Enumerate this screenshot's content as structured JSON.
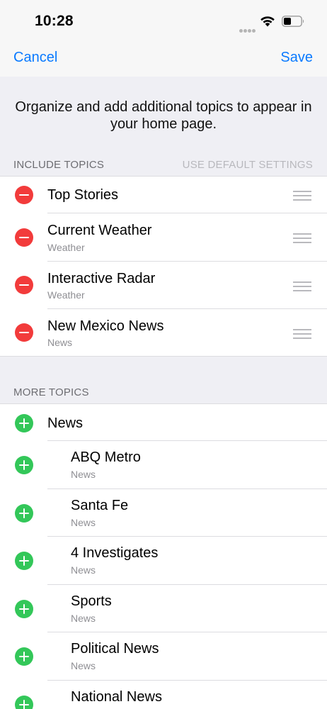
{
  "status_bar": {
    "time": "10:28"
  },
  "nav": {
    "cancel_label": "Cancel",
    "save_label": "Save"
  },
  "intro": {
    "text": "Organize and add additional topics to appear in your home page."
  },
  "include_section": {
    "title": "INCLUDE TOPICS",
    "action_label": "USE DEFAULT SETTINGS"
  },
  "include_topics": [
    {
      "title": "Top Stories"
    },
    {
      "title": "Current Weather",
      "subtitle": "Weather"
    },
    {
      "title": "Interactive Radar",
      "subtitle": "Weather"
    },
    {
      "title": "New Mexico News",
      "subtitle": "News"
    }
  ],
  "more_section": {
    "title": "MORE TOPICS"
  },
  "more_topics": [
    {
      "title": "News"
    },
    {
      "title": "ABQ Metro",
      "subtitle": "News"
    },
    {
      "title": "Santa Fe",
      "subtitle": "News"
    },
    {
      "title": "4 Investigates",
      "subtitle": "News"
    },
    {
      "title": "Sports",
      "subtitle": "News"
    },
    {
      "title": "Political News",
      "subtitle": "News"
    },
    {
      "title": "National News"
    }
  ],
  "colors": {
    "accent": "#0a7aff",
    "remove": "#f23b3b",
    "add": "#33c759"
  },
  "icons": {
    "remove": "minus-circle-icon",
    "add": "plus-circle-icon",
    "reorder": "reorder-icon"
  }
}
